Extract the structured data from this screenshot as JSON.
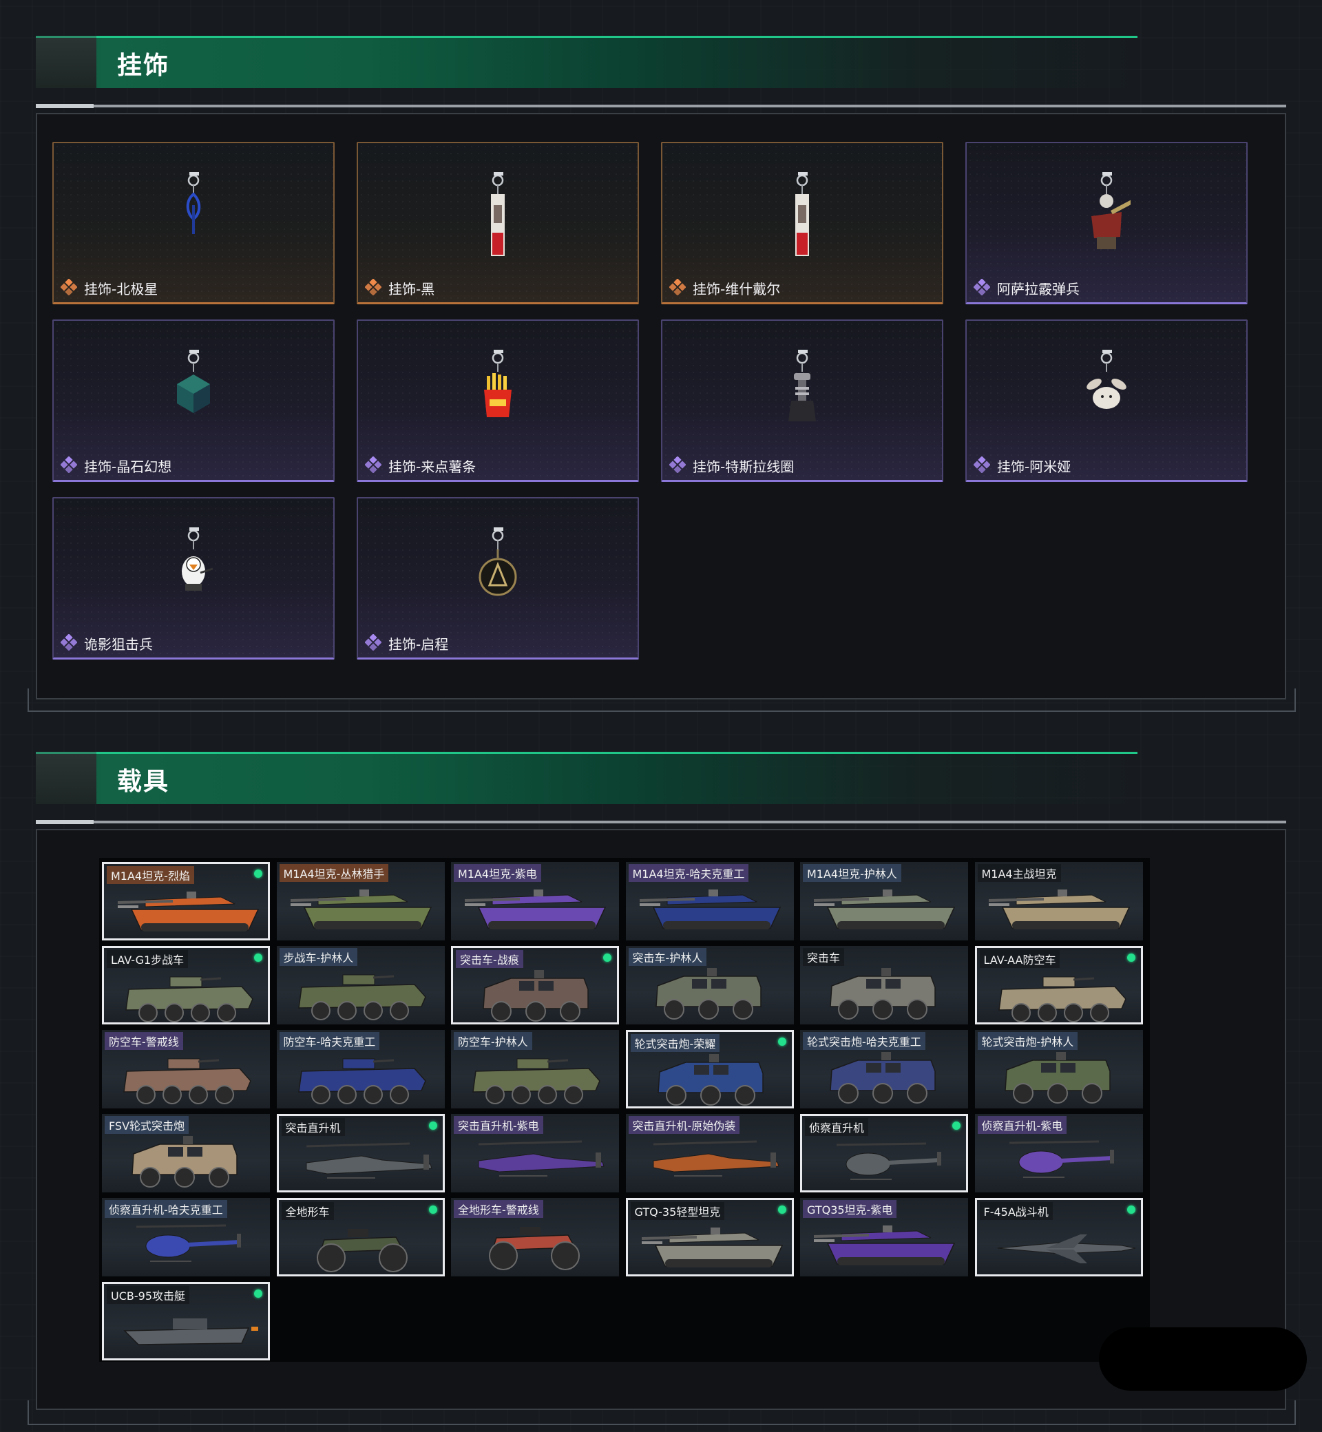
{
  "sections": {
    "charms": {
      "title": "挂饰"
    },
    "vehicles": {
      "title": "载具"
    }
  },
  "charms": [
    {
      "label": "挂饰-北极星",
      "rarity": "orange",
      "icon": "blue-keychain-charm"
    },
    {
      "label": "挂饰-黑",
      "rarity": "orange",
      "icon": "tag-keychain-charm"
    },
    {
      "label": "挂饰-维什戴尔",
      "rarity": "orange",
      "icon": "tag-keychain-charm"
    },
    {
      "label": "阿萨拉霰弹兵",
      "rarity": "purple",
      "icon": "soldier-figure-charm"
    },
    {
      "label": "挂饰-晶石幻想",
      "rarity": "purple",
      "icon": "crystal-cube-charm"
    },
    {
      "label": "挂饰-来点薯条",
      "rarity": "purple",
      "icon": "fries-charm"
    },
    {
      "label": "挂饰-特斯拉线圈",
      "rarity": "purple",
      "icon": "tesla-coil-charm"
    },
    {
      "label": "挂饰-阿米娅",
      "rarity": "purple",
      "icon": "bunny-charm"
    },
    {
      "label": "诡影狙击兵",
      "rarity": "purple",
      "icon": "penguin-sniper-charm"
    },
    {
      "label": "挂饰-启程",
      "rarity": "purple",
      "icon": "medal-charm"
    }
  ],
  "vehicles": [
    {
      "label": "M1A4坦克-烈焰",
      "owned": true,
      "kind": "tank",
      "accent": "#d0602a",
      "tag": "orange"
    },
    {
      "label": "M1A4坦克-丛林猎手",
      "owned": false,
      "kind": "tank",
      "accent": "#6a7a4a",
      "tag": "orange"
    },
    {
      "label": "M1A4坦克-紫电",
      "owned": false,
      "kind": "tank",
      "accent": "#6a4ab0",
      "tag": "purple"
    },
    {
      "label": "M1A4坦克-哈夫克重工",
      "owned": false,
      "kind": "tank",
      "accent": "#2a3e8a",
      "tag": "purple"
    },
    {
      "label": "M1A4坦克-护林人",
      "owned": false,
      "kind": "tank",
      "accent": "#7a8470",
      "tag": "blue"
    },
    {
      "label": "M1A4主战坦克",
      "owned": false,
      "kind": "tank",
      "accent": "#a89878",
      "tag": "none"
    },
    {
      "label": "LAV-G1步战车",
      "owned": true,
      "kind": "apc",
      "accent": "#6f7a5e",
      "tag": "none"
    },
    {
      "label": "步战车-护林人",
      "owned": false,
      "kind": "apc",
      "accent": "#5f6a4a",
      "tag": "blue"
    },
    {
      "label": "突击车-战痕",
      "owned": true,
      "kind": "mrap",
      "accent": "#6d5a52",
      "tag": "purple"
    },
    {
      "label": "突击车-护林人",
      "owned": false,
      "kind": "mrap",
      "accent": "#6a7060",
      "tag": "blue"
    },
    {
      "label": "突击车",
      "owned": false,
      "kind": "mrap",
      "accent": "#7a7a72",
      "tag": "none"
    },
    {
      "label": "LAV-AA防空车",
      "owned": true,
      "kind": "apc",
      "accent": "#a0947a",
      "tag": "none"
    },
    {
      "label": "防空车-警戒线",
      "owned": false,
      "kind": "apc",
      "accent": "#8a6a5a",
      "tag": "purple"
    },
    {
      "label": "防空车-哈夫克重工",
      "owned": false,
      "kind": "apc",
      "accent": "#2e3e88",
      "tag": "blue"
    },
    {
      "label": "防空车-护林人",
      "owned": false,
      "kind": "apc",
      "accent": "#66704e",
      "tag": "blue"
    },
    {
      "label": "轮式突击炮-荣耀",
      "owned": true,
      "kind": "mrap",
      "accent": "#2e4a8a",
      "tag": "blue"
    },
    {
      "label": "轮式突击炮-哈夫克重工",
      "owned": false,
      "kind": "mrap",
      "accent": "#3a4680",
      "tag": "blue"
    },
    {
      "label": "轮式突击炮-护林人",
      "owned": false,
      "kind": "mrap",
      "accent": "#5a6a4a",
      "tag": "blue"
    },
    {
      "label": "FSV轮式突击炮",
      "owned": false,
      "kind": "mrap",
      "accent": "#a89478",
      "tag": "blue"
    },
    {
      "label": "突击直升机",
      "owned": true,
      "kind": "heli",
      "accent": "#5a6064",
      "tag": "none"
    },
    {
      "label": "突击直升机-紫电",
      "owned": false,
      "kind": "heli",
      "accent": "#5a3e9a",
      "tag": "purple"
    },
    {
      "label": "突击直升机-原始伪装",
      "owned": false,
      "kind": "heli",
      "accent": "#b05a2a",
      "tag": "purple"
    },
    {
      "label": "侦察直升机",
      "owned": true,
      "kind": "heli-small",
      "accent": "#5a6064",
      "tag": "none"
    },
    {
      "label": "侦察直升机-紫电",
      "owned": false,
      "kind": "heli-small",
      "accent": "#6a4ab0",
      "tag": "purple"
    },
    {
      "label": "侦察直升机-哈夫克重工",
      "owned": false,
      "kind": "heli-small",
      "accent": "#3a4ab0",
      "tag": "blue"
    },
    {
      "label": "全地形车",
      "owned": true,
      "kind": "atv",
      "accent": "#4e5a40",
      "tag": "none"
    },
    {
      "label": "全地形车-警戒线",
      "owned": false,
      "kind": "atv",
      "accent": "#b04a3a",
      "tag": "purple"
    },
    {
      "label": "GTQ-35轻型坦克",
      "owned": true,
      "kind": "tank",
      "accent": "#8a8a80",
      "tag": "none"
    },
    {
      "label": "GTQ35坦克-紫电",
      "owned": false,
      "kind": "tank",
      "accent": "#5a3aa0",
      "tag": "purple"
    },
    {
      "label": "F-45A战斗机",
      "owned": true,
      "kind": "jet",
      "accent": "#5a6066",
      "tag": "none"
    },
    {
      "label": "UCB-95攻击艇",
      "owned": true,
      "kind": "boat",
      "accent": "#5a6066",
      "tag": "none"
    }
  ]
}
